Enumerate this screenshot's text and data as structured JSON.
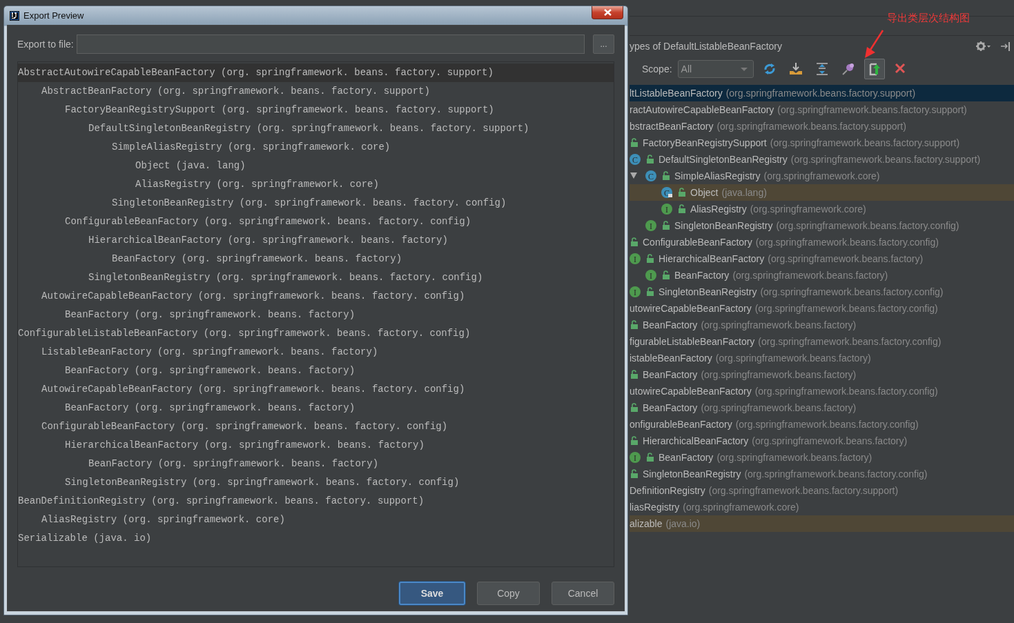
{
  "dialog": {
    "title": "Export Preview",
    "export_label": "Export to file:",
    "browse_button": "...",
    "lines": [
      {
        "text": "AbstractAutowireCapableBeanFactory (org. springframework. beans. factory. support)",
        "current": true,
        "children": [
          {
            "text": "AbstractBeanFactory (org. springframework. beans. factory. support)",
            "children": [
              {
                "text": "FactoryBeanRegistrySupport (org. springframework. beans. factory. support)",
                "children": [
                  {
                    "text": "DefaultSingletonBeanRegistry (org. springframework. beans. factory. support)",
                    "children": [
                      {
                        "text": "SimpleAliasRegistry (org. springframework. core)",
                        "children": [
                          {
                            "text": "Object (java. lang)"
                          },
                          {
                            "text": "AliasRegistry (org. springframework. core)"
                          }
                        ]
                      },
                      {
                        "text": "SingletonBeanRegistry (org. springframework. beans. factory. config)"
                      }
                    ]
                  }
                ]
              },
              {
                "text": "ConfigurableBeanFactory (org. springframework. beans. factory. config)",
                "children": [
                  {
                    "text": "HierarchicalBeanFactory (org. springframework. beans. factory)",
                    "children": [
                      {
                        "text": "BeanFactory (org. springframework. beans. factory)"
                      }
                    ]
                  },
                  {
                    "text": "SingletonBeanRegistry (org. springframework. beans. factory. config)"
                  }
                ]
              }
            ]
          },
          {
            "text": "AutowireCapableBeanFactory (org. springframework. beans. factory. config)",
            "children": [
              {
                "text": "BeanFactory (org. springframework. beans. factory)"
              }
            ]
          }
        ]
      },
      {
        "text": "ConfigurableListableBeanFactory (org. springframework. beans. factory. config)",
        "children": [
          {
            "text": "ListableBeanFactory (org. springframework. beans. factory)",
            "children": [
              {
                "text": "BeanFactory (org. springframework. beans. factory)"
              }
            ]
          },
          {
            "text": "AutowireCapableBeanFactory (org. springframework. beans. factory. config)",
            "children": [
              {
                "text": "BeanFactory (org. springframework. beans. factory)"
              }
            ]
          },
          {
            "text": "ConfigurableBeanFactory (org. springframework. beans. factory. config)",
            "children": [
              {
                "text": "HierarchicalBeanFactory (org. springframework. beans. factory)",
                "children": [
                  {
                    "text": "BeanFactory (org. springframework. beans. factory)"
                  }
                ]
              },
              {
                "text": "SingletonBeanRegistry (org. springframework. beans. factory. config)"
              }
            ]
          }
        ]
      },
      {
        "text": "BeanDefinitionRegistry (org. springframework. beans. factory. support)",
        "children": [
          {
            "text": "AliasRegistry (org. springframework. core)"
          }
        ]
      },
      {
        "text": "Serializable (java. io)"
      }
    ],
    "buttons": [
      {
        "label": "Save",
        "default": true
      },
      {
        "label": "Copy",
        "default": false
      },
      {
        "label": "Cancel",
        "default": false
      }
    ]
  },
  "hierarchy": {
    "title": "ypes of DefaultListableBeanFactory",
    "scope_label": "Scope:",
    "scope_value": "All",
    "toolbar": [
      {
        "kind": "refresh",
        "selected": false
      },
      {
        "kind": "download",
        "selected": false
      },
      {
        "kind": "expand",
        "selected": false
      },
      {
        "kind": "pin",
        "selected": false
      },
      {
        "kind": "export",
        "selected": true
      },
      {
        "kind": "close",
        "selected": false
      }
    ],
    "tree": [
      {
        "name": "ltListableBeanFactory",
        "package": "(org.springframework.beans.factory.support)",
        "selected": true,
        "highlighted": false,
        "children": [
          {
            "name": "ractAutowireCapableBeanFactory",
            "package": "(org.springframework.beans.factory.support)",
            "selected": false,
            "highlighted": false,
            "children": [
              {
                "name": "bstractBeanFactory",
                "package": "(org.springframework.beans.factory.support)",
                "selected": false,
                "highlighted": false,
                "children": [
                  {
                    "name": "FactoryBeanRegistrySupport",
                    "package": "(org.springframework.beans.factory.support)",
                    "selected": false,
                    "highlighted": false,
                    "children": [
                      {
                        "name": "DefaultSingletonBeanRegistry",
                        "package": "(org.springframework.beans.factory.support)",
                        "kind": "class",
                        "badge": "C",
                        "selected": false,
                        "highlighted": false,
                        "children": [
                          {
                            "name": "SimpleAliasRegistry",
                            "package": "(org.springframework.core)",
                            "kind": "class",
                            "badge": "C",
                            "expanded": true,
                            "selected": false,
                            "highlighted": false,
                            "children": [
                              {
                                "name": "Object",
                                "package": "(java.lang)",
                                "kind": "locked-class",
                                "badge": "C",
                                "selected": false,
                                "highlighted": true
                              },
                              {
                                "name": "AliasRegistry",
                                "package": "(org.springframework.core)",
                                "kind": "interface",
                                "badge": "I",
                                "selected": false,
                                "highlighted": false
                              }
                            ]
                          },
                          {
                            "name": "SingletonBeanRegistry",
                            "package": "(org.springframework.beans.factory.config)",
                            "kind": "interface",
                            "badge": "I",
                            "selected": false,
                            "highlighted": false
                          }
                        ]
                      }
                    ]
                  },
                  {
                    "name": "ConfigurableBeanFactory",
                    "package": "(org.springframework.beans.factory.config)",
                    "selected": false,
                    "highlighted": false,
                    "children": [
                      {
                        "name": "HierarchicalBeanFactory",
                        "package": "(org.springframework.beans.factory)",
                        "kind": "interface",
                        "badge": "I",
                        "selected": false,
                        "highlighted": false,
                        "children": [
                          {
                            "name": "BeanFactory",
                            "package": "(org.springframework.beans.factory)",
                            "kind": "interface",
                            "badge": "I",
                            "selected": false,
                            "highlighted": false
                          }
                        ]
                      },
                      {
                        "name": "SingletonBeanRegistry",
                        "package": "(org.springframework.beans.factory.config)",
                        "kind": "interface",
                        "badge": "I",
                        "selected": false,
                        "highlighted": false
                      }
                    ]
                  }
                ]
              },
              {
                "name": "utowireCapableBeanFactory",
                "package": "(org.springframework.beans.factory.config)",
                "selected": false,
                "highlighted": false,
                "children": [
                  {
                    "name": "BeanFactory",
                    "package": "(org.springframework.beans.factory)",
                    "selected": false,
                    "highlighted": false
                  }
                ]
              }
            ]
          },
          {
            "name": "figurableListableBeanFactory",
            "package": "(org.springframework.beans.factory.config)",
            "selected": false,
            "highlighted": false,
            "children": [
              {
                "name": "istableBeanFactory",
                "package": "(org.springframework.beans.factory)",
                "selected": false,
                "highlighted": false,
                "children": [
                  {
                    "name": "BeanFactory",
                    "package": "(org.springframework.beans.factory)",
                    "selected": false,
                    "highlighted": false
                  }
                ]
              },
              {
                "name": "utowireCapableBeanFactory",
                "package": "(org.springframework.beans.factory.config)",
                "selected": false,
                "highlighted": false,
                "children": [
                  {
                    "name": "BeanFactory",
                    "package": "(org.springframework.beans.factory)",
                    "selected": false,
                    "highlighted": false
                  }
                ]
              },
              {
                "name": "onfigurableBeanFactory",
                "package": "(org.springframework.beans.factory.config)",
                "selected": false,
                "highlighted": false,
                "children": [
                  {
                    "name": "HierarchicalBeanFactory",
                    "package": "(org.springframework.beans.factory)",
                    "selected": false,
                    "highlighted": false,
                    "children": [
                      {
                        "name": "BeanFactory",
                        "package": "(org.springframework.beans.factory)",
                        "kind": "interface",
                        "badge": "I",
                        "selected": false,
                        "highlighted": false
                      }
                    ]
                  },
                  {
                    "name": "SingletonBeanRegistry",
                    "package": "(org.springframework.beans.factory.config)",
                    "selected": false,
                    "highlighted": false
                  }
                ]
              }
            ]
          },
          {
            "name": "DefinitionRegistry",
            "package": "(org.springframework.beans.factory.support)",
            "selected": false,
            "highlighted": false,
            "children": [
              {
                "name": "liasRegistry",
                "package": "(org.springframework.core)",
                "selected": false,
                "highlighted": false
              }
            ]
          },
          {
            "name": "alizable",
            "package": "(java.io)",
            "selected": false,
            "highlighted": true
          }
        ]
      }
    ]
  },
  "annotation": {
    "text": "导出类层次结构图"
  }
}
